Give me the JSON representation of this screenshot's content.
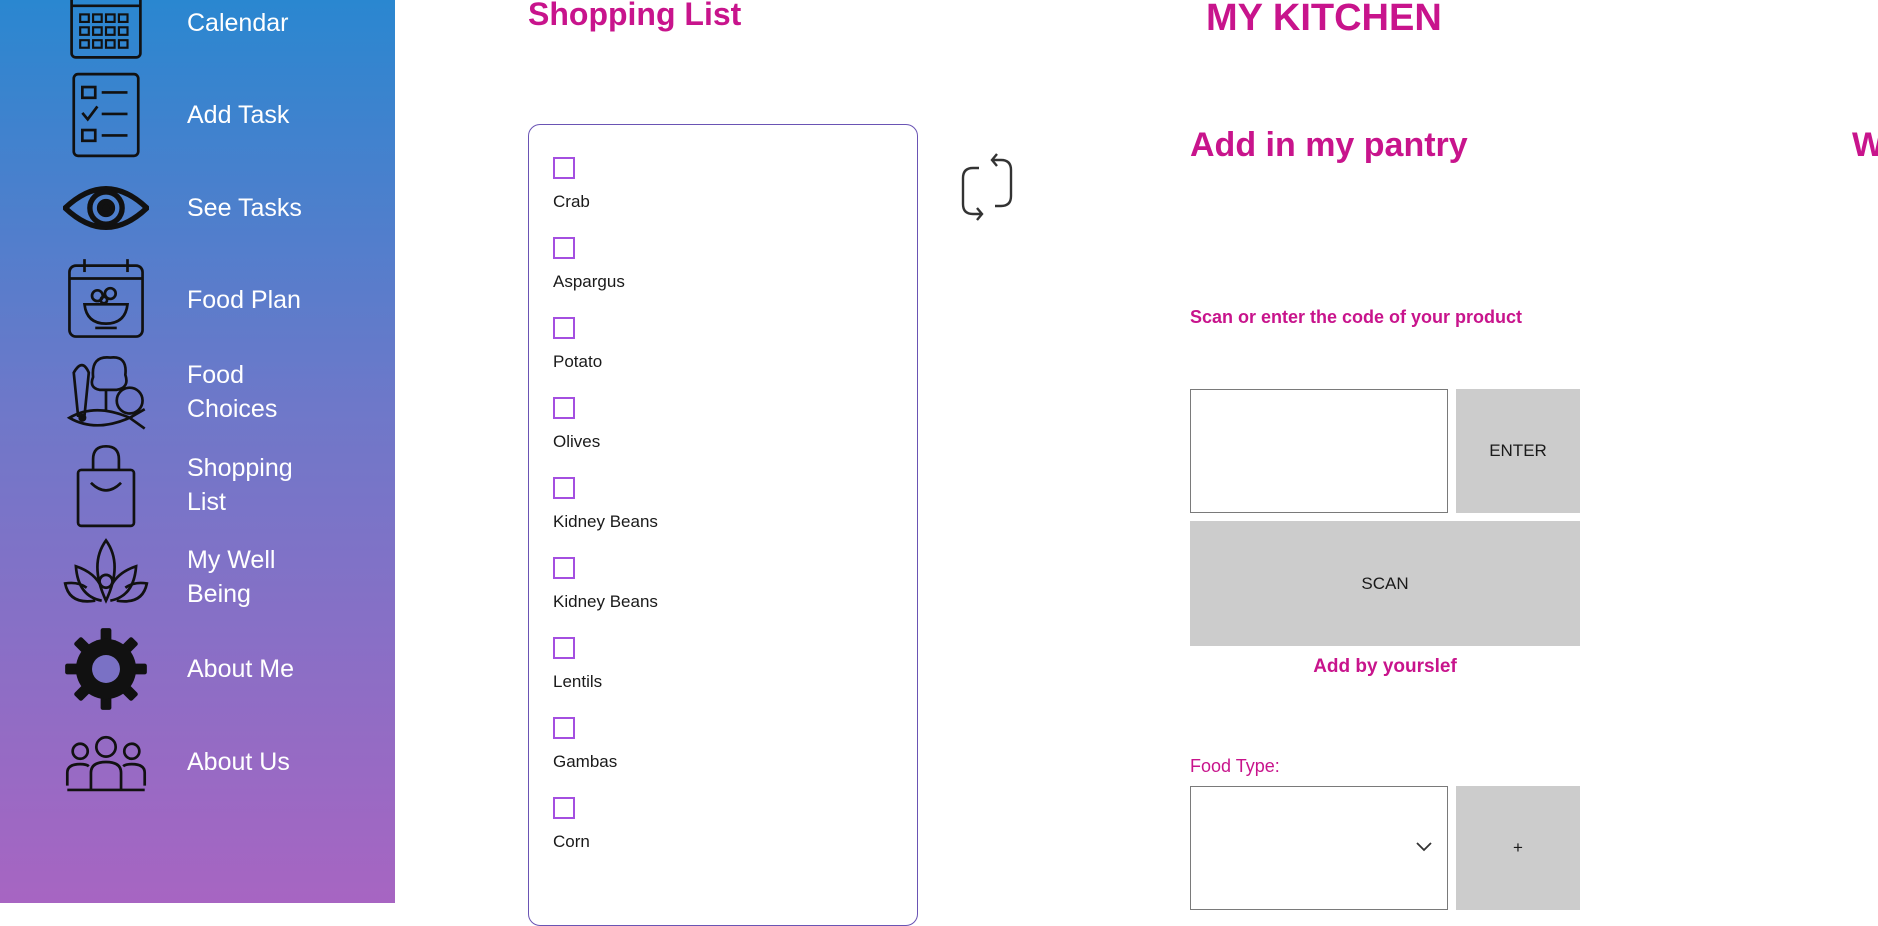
{
  "sidebar": {
    "items": [
      {
        "label": "Calendar",
        "icon": "calendar-icon"
      },
      {
        "label": "Add Task",
        "icon": "checklist-icon"
      },
      {
        "label": "See Tasks",
        "icon": "eye-icon"
      },
      {
        "label": "Food Plan",
        "icon": "food-plan-icon"
      },
      {
        "label": "Food\nChoices",
        "icon": "vegetables-icon"
      },
      {
        "label": "Shopping\nList",
        "icon": "shopping-bag-icon"
      },
      {
        "label": "My Well\nBeing",
        "icon": "lotus-icon"
      },
      {
        "label": "About Me",
        "icon": "gear-icon"
      },
      {
        "label": "About Us",
        "icon": "group-icon"
      }
    ],
    "gradient": [
      "#2a87d0",
      "#a765c2"
    ]
  },
  "shopping": {
    "title": "Shopping List",
    "items": [
      {
        "label": "Crab",
        "checked": false
      },
      {
        "label": "Aspargus",
        "checked": false
      },
      {
        "label": "Potato",
        "checked": false
      },
      {
        "label": "Olives",
        "checked": false
      },
      {
        "label": "Kidney Beans",
        "checked": false
      },
      {
        "label": "Kidney Beans",
        "checked": false
      },
      {
        "label": "Lentils",
        "checked": false
      },
      {
        "label": "Gambas",
        "checked": false
      },
      {
        "label": "Corn",
        "checked": false
      }
    ],
    "refresh_icon": "refresh-icon"
  },
  "kitchen": {
    "title": "MY KITCHEN",
    "pantry_title": "Add in my pantry",
    "next_section_initial": "W",
    "scan_label": "Scan or enter the code of your product",
    "code_input_value": "",
    "enter_label": "ENTER",
    "scan_button_label": "SCAN",
    "add_yourself_label": "Add by yourslef",
    "food_type_label": "Food Type:",
    "food_type_value": "",
    "plus_label": "+"
  },
  "colors": {
    "accent": "#c8148c",
    "checkbox": "#a44fe0",
    "button": "#cccccc",
    "list_border": "#6a54b4"
  }
}
